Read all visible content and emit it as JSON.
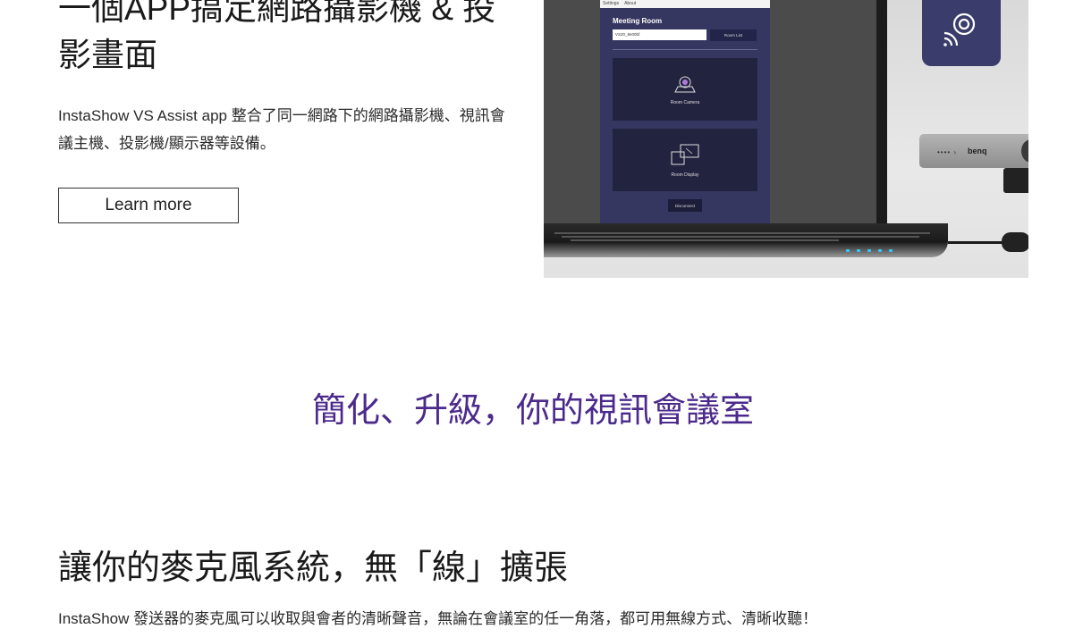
{
  "hero": {
    "title": "一個APP搞定網路攝影機 & 投影畫面",
    "description": "InstaShow VS Assist app 整合了同一網路下的網路攝影機、視訊會議主機、投影機/顯示器等設備。",
    "learn_more_label": "Learn more"
  },
  "app_screenshot": {
    "menu": [
      "Settings",
      "About"
    ],
    "heading": "Meeting Room",
    "device_id": "VS20_9e00bf",
    "room_list_label": "Room List",
    "cards": [
      {
        "label": "Room Camera",
        "icon": "camera-icon"
      },
      {
        "label": "Room Display",
        "icon": "display-icon"
      }
    ],
    "disconnect_label": "Disconnect"
  },
  "camera_device": {
    "brand": "benq"
  },
  "section": {
    "title": "簡化、升級，你的視訊會議室"
  },
  "microphone": {
    "title": "讓你的麥克風系統，無「線」擴張",
    "description": "InstaShow 發送器的麥克風可以收取與會者的清晰聲音，無論在會議室的任一角落，都可用無線方式、清晰收聽！"
  },
  "colors": {
    "accent_purple": "#4b2a8c",
    "app_background": "#363761",
    "icon_tile": "#3a3d6b"
  }
}
